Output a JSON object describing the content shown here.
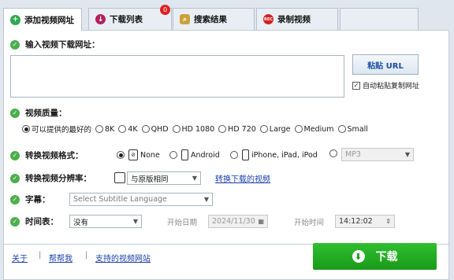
{
  "tabs": [
    {
      "label": "添加视频网址",
      "icon": "plus-icon",
      "color": "#2fa84f"
    },
    {
      "label": "下载列表",
      "icon": "download-icon",
      "color": "#b2225a"
    },
    {
      "label": "搜索结果",
      "icon": "search-icon",
      "color": "#caa23a"
    },
    {
      "label": "录制视频",
      "icon": "rec-icon",
      "color": "#d42020",
      "icon_text": "REC"
    }
  ],
  "download_badge": "0",
  "url_section": {
    "label": "输入视频下载网址：",
    "value": "",
    "paste_button": "粘贴 URL",
    "autopaste_label": "自动粘贴复制网址",
    "autopaste_checked": true
  },
  "quality": {
    "label": "视频质量：",
    "options": [
      "可以提供的最好的",
      "8K",
      "4K",
      "QHD",
      "HD 1080",
      "HD 720",
      "Large",
      "Medium",
      "Small"
    ],
    "selected": "可以提供的最好的"
  },
  "format": {
    "label": "转换视频格式：",
    "options": [
      "None",
      "Android",
      "iPhone, iPad, iPod"
    ],
    "selected": "None",
    "mp3_value": "MP3"
  },
  "resolution": {
    "label": "转换视频分辨率：",
    "value": "与原版相同",
    "link": "转换下载的视频"
  },
  "subtitle": {
    "label": "字幕：",
    "placeholder": "Select Subtitle Language"
  },
  "schedule": {
    "label": "时间表：",
    "value": "没有",
    "start_date_label": "开始日期",
    "start_date": "2024/11/30",
    "start_time_label": "开始时间",
    "start_time": "14:12:02"
  },
  "footer": {
    "about": "关于",
    "help": "帮帮我",
    "sites": "支持的视频网站",
    "download": "下载"
  },
  "colors": {
    "accent_green": "#1a9a1a",
    "link_blue": "#1a3faa"
  }
}
